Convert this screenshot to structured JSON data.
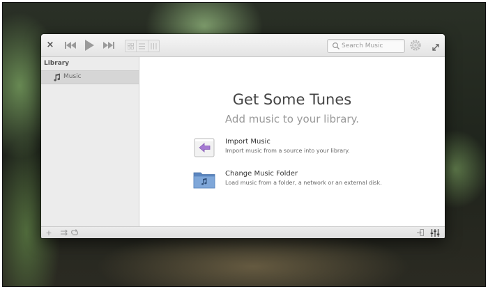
{
  "window": {
    "toolbar": {
      "close_glyph": "×",
      "search_placeholder": "Search Music"
    },
    "sidebar": {
      "header": "Library",
      "items": [
        {
          "label": "Music",
          "icon": "music-note-icon",
          "selected": true
        }
      ]
    },
    "welcome": {
      "title": "Get Some Tunes",
      "subtitle": "Add music to your library.",
      "actions": [
        {
          "title": "Import Music",
          "description": "Import music from a source into your library.",
          "icon": "import-arrow-icon"
        },
        {
          "title": "Change Music Folder",
          "description": "Load music from a folder, a network or an external disk.",
          "icon": "music-folder-icon"
        }
      ]
    },
    "statusbar": {
      "add_glyph": "+"
    }
  }
}
